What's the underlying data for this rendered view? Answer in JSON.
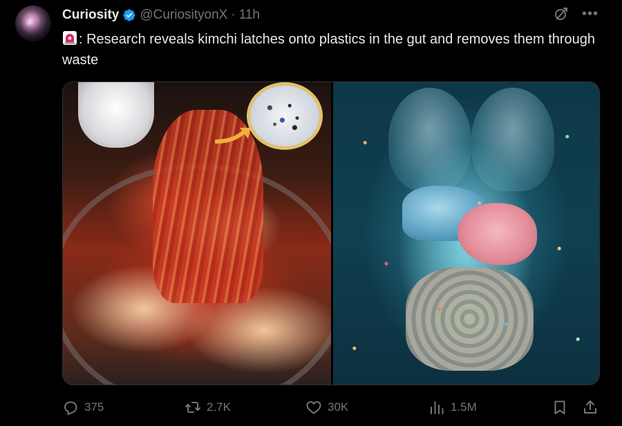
{
  "tweet": {
    "author_name": "Curiosity",
    "handle": "@CuriosityonX",
    "separator": "·",
    "time": "11h",
    "text": ": Research reveals kimchi latches onto plastics in the gut and removes them through waste",
    "emoji_icon": "rotating-light-icon"
  },
  "stats": {
    "replies": "375",
    "reposts": "2.7K",
    "likes": "30K",
    "views": "1.5M"
  },
  "colors": {
    "background": "#000000",
    "text": "#e7e9ea",
    "muted": "#71767b",
    "verified": "#1d9bf0"
  },
  "icons": {
    "verified": "verified-badge-icon",
    "grok": "grok-icon",
    "more": "more-icon",
    "reply": "reply-icon",
    "repost": "repost-icon",
    "like": "heart-icon",
    "views": "views-chart-icon",
    "bookmark": "bookmark-icon",
    "share": "share-icon"
  }
}
